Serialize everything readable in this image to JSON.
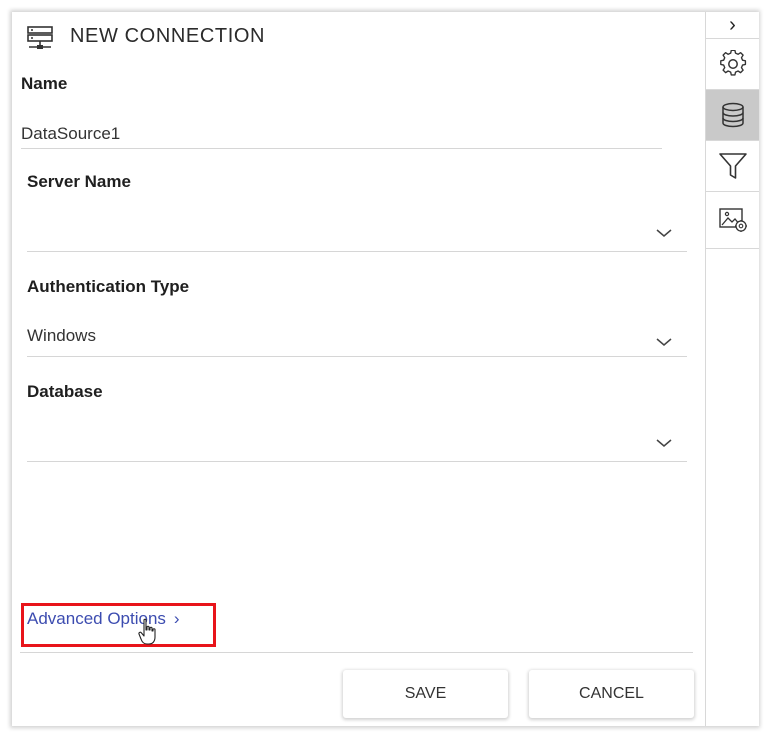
{
  "header": {
    "title": "NEW CONNECTION",
    "icon": "server-icon"
  },
  "form": {
    "name": {
      "label": "Name",
      "value": "DataSource1"
    },
    "server_name": {
      "label": "Server Name",
      "value": ""
    },
    "authentication_type": {
      "label": "Authentication Type",
      "value": "Windows"
    },
    "database": {
      "label": "Database",
      "value": ""
    }
  },
  "advanced_options": {
    "label": "Advanced Options",
    "chevron": "›",
    "link_color": "#3c4cb0",
    "highlight_color": "#e8141a"
  },
  "footer": {
    "save_label": "SAVE",
    "cancel_label": "CANCEL"
  },
  "sidebar": {
    "collapse_glyph": "›",
    "items": [
      {
        "icon": "gear-icon",
        "active": false
      },
      {
        "icon": "database-icon",
        "active": true
      },
      {
        "icon": "filter-icon",
        "active": false
      },
      {
        "icon": "image-settings-icon",
        "active": false
      }
    ]
  }
}
